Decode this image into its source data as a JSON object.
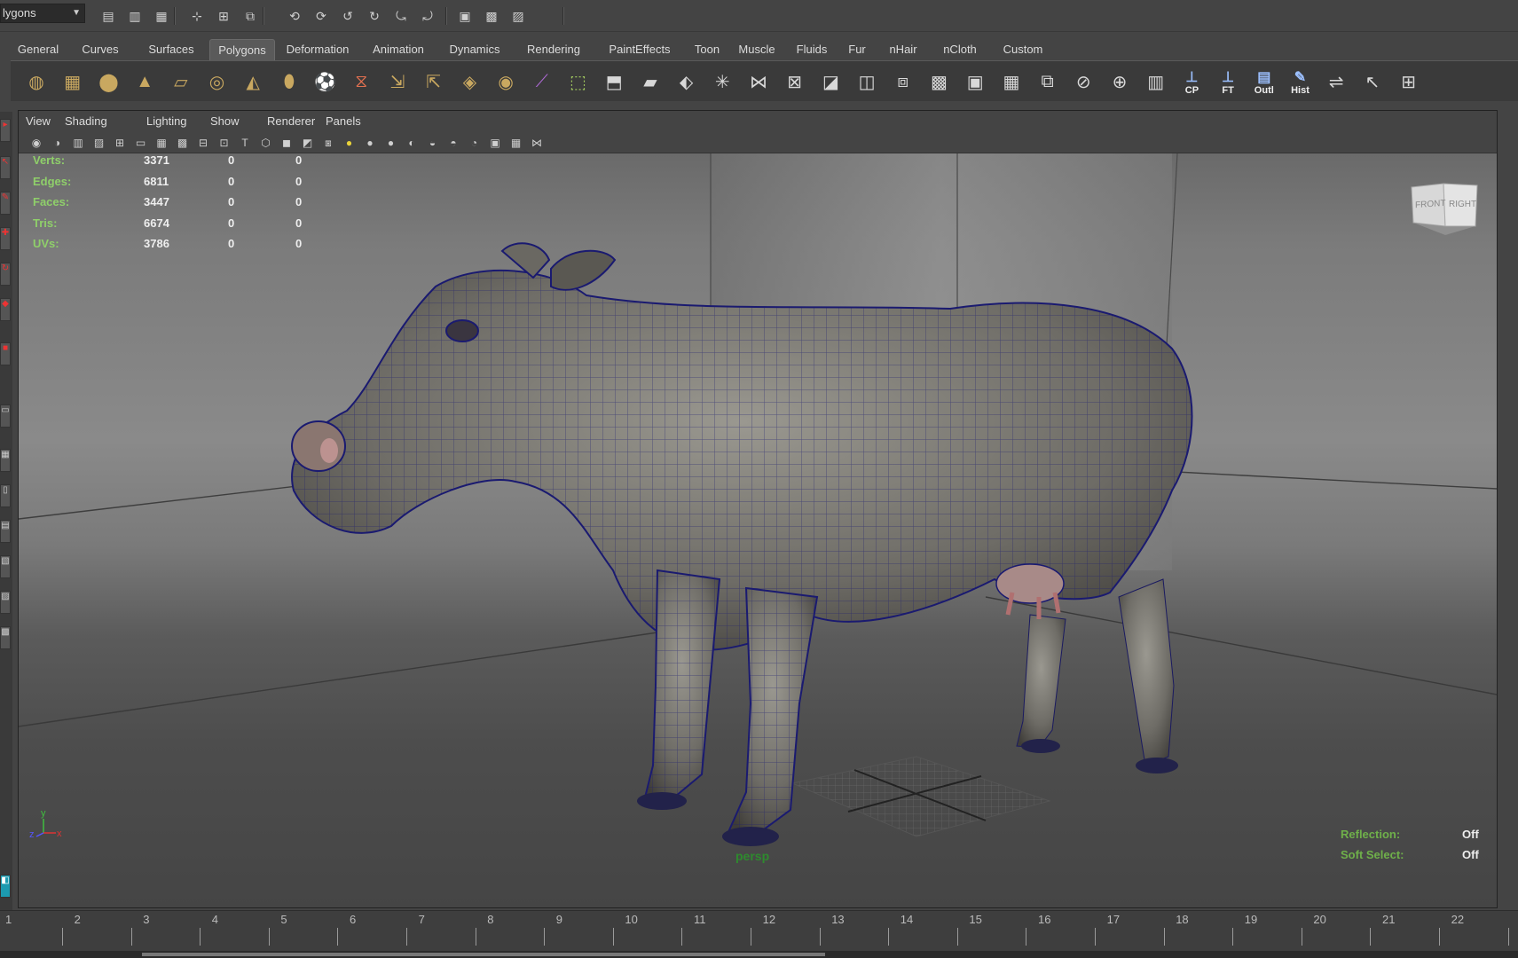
{
  "status_line": {
    "mode_value": "lygons",
    "icons": [
      "new-scene-icon",
      "open-scene-icon",
      "save-scene-icon",
      "select-hierarchy-icon",
      "select-object-icon",
      "select-component-icon",
      "snap-grid-icon",
      "snap-curve-icon",
      "snap-point-icon",
      "snap-plane-icon",
      "snap-surface-icon",
      "render-view-icon",
      "render-frame-icon",
      "ipr-render-icon",
      "render-settings-icon"
    ]
  },
  "shelf_tabs": [
    "General",
    "Curves",
    "Surfaces",
    "Polygons",
    "Deformation",
    "Animation",
    "Dynamics",
    "Rendering",
    "PaintEffects",
    "Toon",
    "Muscle",
    "Fluids",
    "Fur",
    "nHair",
    "nCloth",
    "Custom"
  ],
  "active_shelf_tab": "Polygons",
  "shelf_buttons": [
    {
      "name": "poly-sphere-icon",
      "label": ""
    },
    {
      "name": "poly-cube-icon",
      "label": ""
    },
    {
      "name": "poly-cylinder-icon",
      "label": ""
    },
    {
      "name": "poly-cone-icon",
      "label": ""
    },
    {
      "name": "poly-plane-icon",
      "label": ""
    },
    {
      "name": "poly-torus-icon",
      "label": ""
    },
    {
      "name": "poly-pyramid-icon",
      "label": ""
    },
    {
      "name": "poly-pipe-icon",
      "label": ""
    },
    {
      "name": "poly-soccerball-icon",
      "label": ""
    },
    {
      "name": "poly-helix-icon",
      "label": ""
    },
    {
      "name": "combine-icon",
      "label": ""
    },
    {
      "name": "separate-icon",
      "label": ""
    },
    {
      "name": "smooth-proxy-icon",
      "label": ""
    },
    {
      "name": "smooth-icon",
      "label": ""
    },
    {
      "name": "split-polygon-icon",
      "label": ""
    },
    {
      "name": "extrude-icon",
      "label": ""
    },
    {
      "name": "bridge-icon",
      "label": ""
    },
    {
      "name": "append-polygon-icon",
      "label": ""
    },
    {
      "name": "wedge-icon",
      "label": ""
    },
    {
      "name": "poke-icon",
      "label": ""
    },
    {
      "name": "merge-icon",
      "label": ""
    },
    {
      "name": "collapse-icon",
      "label": ""
    },
    {
      "name": "bevel-icon",
      "label": ""
    },
    {
      "name": "chamfer-icon",
      "label": ""
    },
    {
      "name": "duplicate-face-icon",
      "label": ""
    },
    {
      "name": "planar-map-icon",
      "label": ""
    },
    {
      "name": "cylindrical-map-icon",
      "label": ""
    },
    {
      "name": "checker-map-icon",
      "label": ""
    },
    {
      "name": "sew-uv-icon",
      "label": ""
    },
    {
      "name": "cut-uv-icon",
      "label": ""
    },
    {
      "name": "unfold-uv-icon",
      "label": ""
    },
    {
      "name": "uv-editor-icon",
      "label": ""
    },
    {
      "name": "center-pivot-icon",
      "label": "CP"
    },
    {
      "name": "freeze-transform-icon",
      "label": "FT"
    },
    {
      "name": "outliner-icon",
      "label": "Outl"
    },
    {
      "name": "history-icon",
      "label": "Hist"
    },
    {
      "name": "transfer-attributes-icon",
      "label": ""
    },
    {
      "name": "select-tool-icon",
      "label": ""
    },
    {
      "name": "measure-icon",
      "label": ""
    }
  ],
  "panel_menu": [
    "View",
    "Shading",
    "Lighting",
    "Show",
    "Renderer",
    "Panels"
  ],
  "panel_toolbar_icons": [
    "camera-select-icon",
    "camera-attr-icon",
    "bookmark-icon",
    "image-plane-icon",
    "grid-toggle-icon",
    "film-gate-icon",
    "resolution-gate-icon",
    "gate-mask-icon",
    "field-chart-icon",
    "safe-action-icon",
    "safe-title-icon",
    "wireframe-icon",
    "smooth-shade-icon",
    "wireframe-on-shaded-icon",
    "textured-icon",
    "default-light-icon",
    "all-lights-icon",
    "shadows-icon",
    "xray-icon",
    "xray-joints-icon",
    "xray-components-icon",
    "isolate-select-icon",
    "two-panel-icon",
    "four-panel-icon",
    "graph-icon"
  ],
  "hud_stats": [
    {
      "label": "Verts:",
      "v1": "3371",
      "v2": "0",
      "v3": "0"
    },
    {
      "label": "Edges:",
      "v1": "6811",
      "v2": "0",
      "v3": "0"
    },
    {
      "label": "Faces:",
      "v1": "3447",
      "v2": "0",
      "v3": "0"
    },
    {
      "label": "Tris:",
      "v1": "6674",
      "v2": "0",
      "v3": "0"
    },
    {
      "label": "UVs:",
      "v1": "3786",
      "v2": "0",
      "v3": "0"
    }
  ],
  "viewcube": {
    "front": "FRONT",
    "right": "RIGHT"
  },
  "camera_name": "persp",
  "hud_right": [
    {
      "label": "Reflection:",
      "value": "Off"
    },
    {
      "label": "Soft Select:",
      "value": "Off"
    }
  ],
  "axis": {
    "y": "y",
    "z": "z",
    "x": "x"
  },
  "timeline_ticks": [
    "1",
    "2",
    "3",
    "4",
    "5",
    "6",
    "7",
    "8",
    "9",
    "10",
    "11",
    "12",
    "13",
    "14",
    "15",
    "16",
    "17",
    "18",
    "19",
    "20",
    "21",
    "22"
  ],
  "colors": {
    "hud_label": "#8fcf6a",
    "wireframe": "#1a1a7a",
    "accent_red": "#dd3333"
  }
}
